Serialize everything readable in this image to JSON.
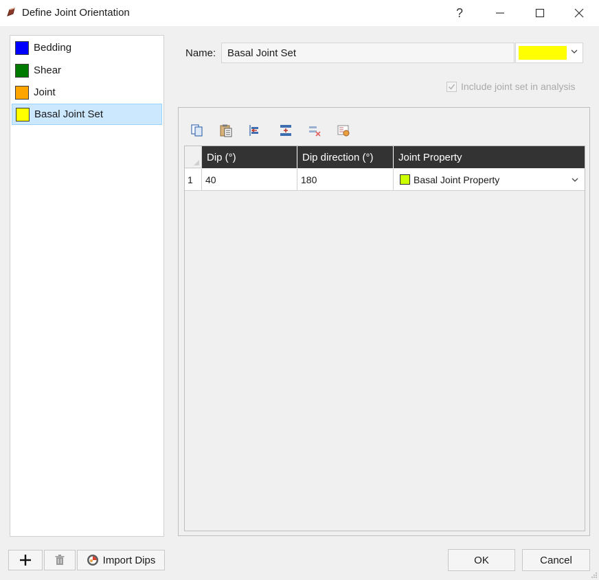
{
  "window": {
    "title": "Define Joint Orientation",
    "help_glyph": "?",
    "minimize_glyph": "—",
    "close_glyph": "✕"
  },
  "joint_list": [
    {
      "label": "Bedding",
      "color": "#0000ff",
      "selected": false
    },
    {
      "label": "Shear",
      "color": "#007a00",
      "selected": false
    },
    {
      "label": "Joint",
      "color": "#ffa500",
      "selected": false
    },
    {
      "label": "Basal Joint Set",
      "color": "#ffff00",
      "selected": true
    }
  ],
  "bottom_left": {
    "add_glyph": "+",
    "import_label": "Import Dips"
  },
  "name_field": {
    "label": "Name:",
    "value": "Basal Joint Set",
    "color": "#ffff00"
  },
  "include": {
    "label": "Include joint set in analysis",
    "checked": true,
    "enabled": false
  },
  "toolbar": {
    "icons": [
      "copy-icon",
      "paste-icon",
      "insert-row-icon",
      "add-row-icon",
      "delete-row-icon",
      "properties-icon"
    ]
  },
  "table": {
    "columns": [
      "Dip (°)",
      "Dip direction (°)",
      "Joint Property"
    ],
    "rows": [
      {
        "num": "1",
        "dip": "40",
        "dip_direction": "180",
        "property": "Basal Joint Property",
        "property_color": "#ccff00"
      }
    ]
  },
  "buttons": {
    "ok": "OK",
    "cancel": "Cancel"
  }
}
